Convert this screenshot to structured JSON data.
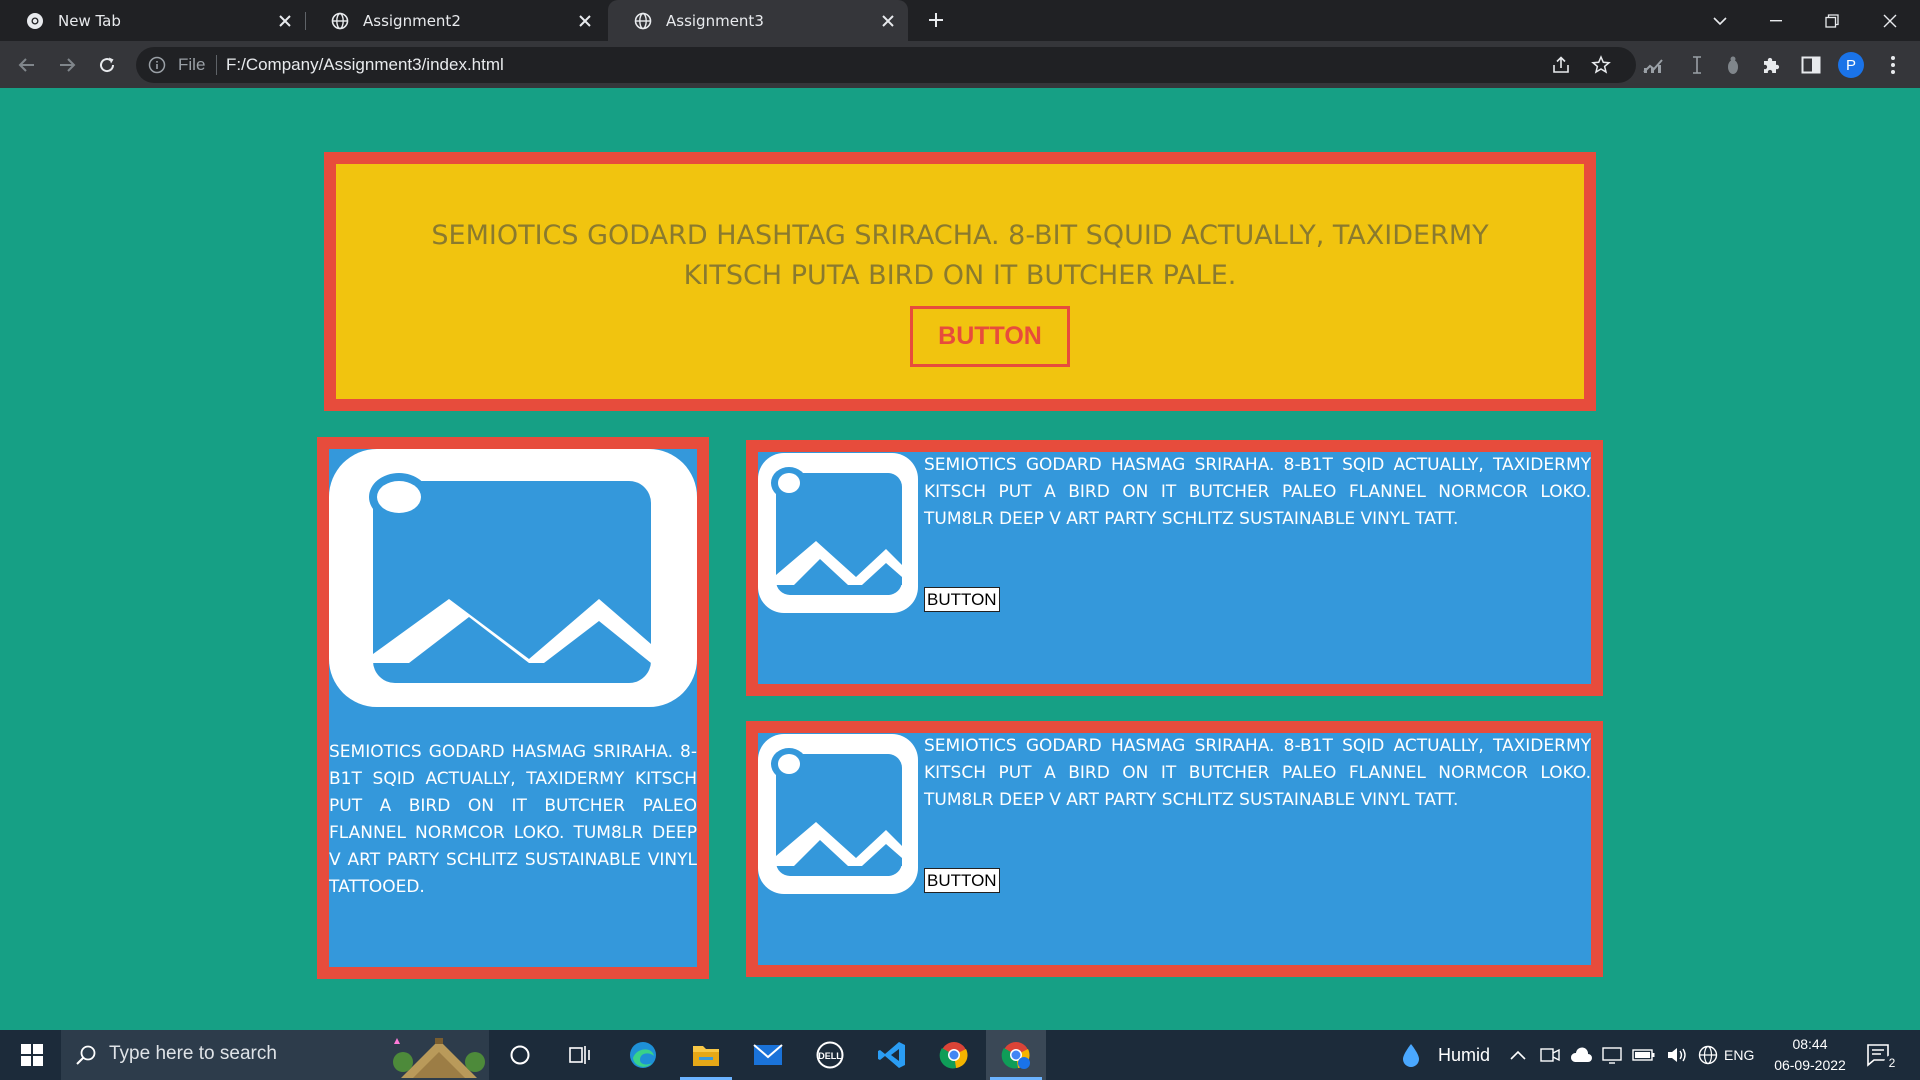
{
  "browser": {
    "tabs": [
      {
        "title": "New Tab",
        "icon": "chrome-icon"
      },
      {
        "title": "Assignment2",
        "icon": "globe-icon"
      },
      {
        "title": "Assignment3",
        "icon": "globe-icon",
        "active": true
      }
    ],
    "address": {
      "scheme_label": "File",
      "url": "F:/Company/Assignment3/index.html"
    },
    "profile_initial": "P"
  },
  "page": {
    "background": "#16a085",
    "hero": {
      "text": "SEMIOTICS GODARD HASHTAG SRIRACHA. 8-BIT SQUID ACTUALLY, TAXIDERMY KITSCH PUTA BIRD ON IT BUTCHER PALE.",
      "button_label": "BUTTON",
      "background": "#f1c40f",
      "border_color": "#e74c3c"
    },
    "left_card": {
      "text": "SEMIOTICS GODARD HASMAG SRIRAHA. 8-B1T SQID ACTUALLY, TAXIDERMY KITSCH PUT A BIRD ON IT BUTCHER PALEO FLANNEL NORMCOR LOKO. TUM8LR DEEP V ART PARTY SCHLITZ SUSTAINABLE VINYL TATTOOED.",
      "background": "#3498db"
    },
    "right_cards": [
      {
        "text": "SEMIOTICS GODARD HASMAG SRIRAHA. 8-B1T SQID ACTUALLY, TAXIDERMY KITSCH PUT A BIRD ON IT BUTCHER PALEO FLANNEL NORMCOR LOKO. TUM8LR DEEP V ART PARTY SCHLITZ SUSTAINABLE VINYL TATT.",
        "button_label": "BUTTON"
      },
      {
        "text": "SEMIOTICS GODARD HASMAG SRIRAHA. 8-B1T SQID ACTUALLY, TAXIDERMY KITSCH PUT A BIRD ON IT BUTCHER PALEO FLANNEL NORMCOR LOKO. TUM8LR DEEP V ART PARTY SCHLITZ SUSTAINABLE VINYL TATT.",
        "button_label": "BUTTON"
      }
    ]
  },
  "taskbar": {
    "search_placeholder": "Type here to search",
    "pinned": [
      "cortana-icon",
      "task-view-icon",
      "edge-icon",
      "file-explorer-icon",
      "mail-icon",
      "dell-icon",
      "vscode-icon",
      "chrome-icon",
      "chrome-profile-icon"
    ],
    "weather": "Humid",
    "language": "ENG",
    "time": "08:44",
    "date": "06-09-2022",
    "notifications": "2"
  }
}
